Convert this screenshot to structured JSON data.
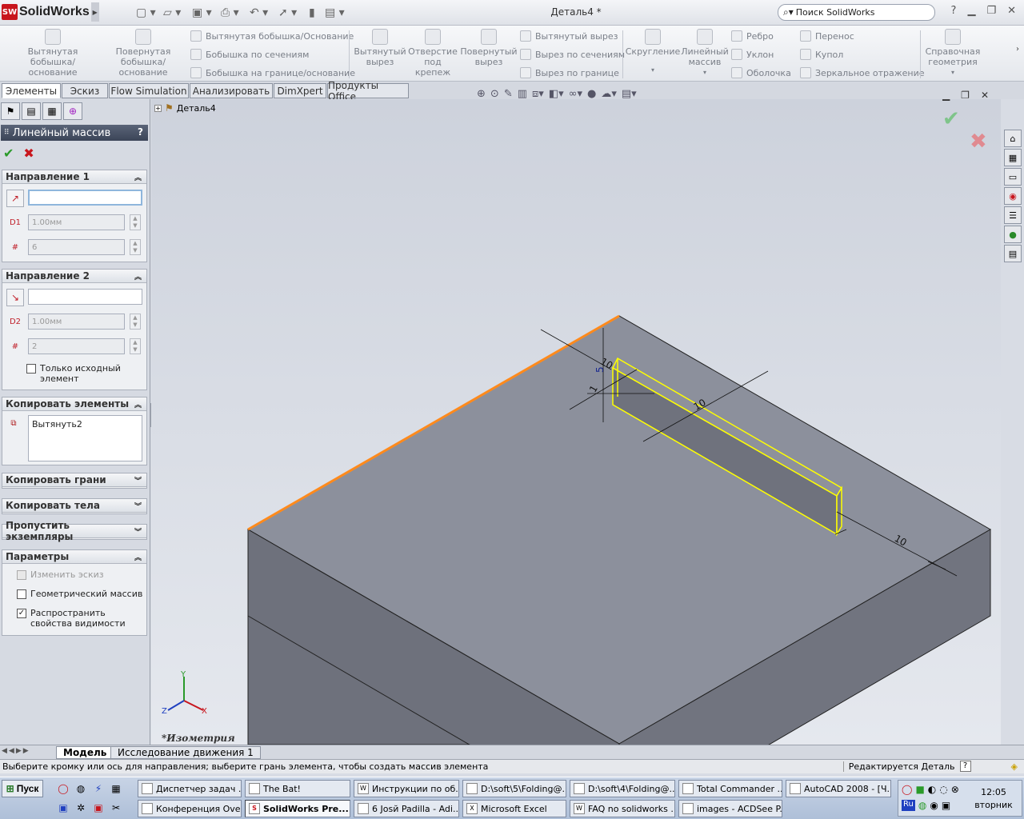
{
  "app": {
    "brand_badge": "SW",
    "brand": "SolidWorks",
    "document_title": "Деталь4 *",
    "search_placeholder": "Поиск SolidWorks",
    "help": "?"
  },
  "commands": {
    "big": [
      {
        "label": "Вытянутая бобышка/основание"
      },
      {
        "label": "Повернутая бобышка/основание"
      },
      {
        "label": "Вытянутый вырез"
      },
      {
        "label": "Отверстие под крепеж"
      },
      {
        "label": "Повернутый вырез"
      },
      {
        "label": "Скругление"
      },
      {
        "label": "Линейный массив"
      },
      {
        "label": "Справочная геометрия"
      }
    ],
    "small": [
      {
        "label": "Вытянутая бобышка/Основание"
      },
      {
        "label": "Бобышка по сечениям"
      },
      {
        "label": "Бобышка на границе/основание"
      },
      {
        "label": "Вытянутый вырез"
      },
      {
        "label": "Вырез по сечениям"
      },
      {
        "label": "Вырез по границе"
      },
      {
        "label": "Ребро"
      },
      {
        "label": "Уклон"
      },
      {
        "label": "Оболочка"
      },
      {
        "label": "Перенос"
      },
      {
        "label": "Купол"
      },
      {
        "label": "Зеркальное отражение"
      }
    ]
  },
  "tabs": [
    "Элементы",
    "Эскиз",
    "Flow Simulation",
    "Анализировать",
    "DimXpert",
    "Продукты Office"
  ],
  "property_manager": {
    "title": "Линейный массив",
    "help": "?",
    "direction1": {
      "header": "Направление 1",
      "distance_icon_label": "D1",
      "count_icon_label": "#",
      "spacing": "1.00мм",
      "count": "6"
    },
    "direction2": {
      "header": "Направление 2",
      "distance_icon_label": "D2",
      "count_icon_label": "#",
      "spacing": "1.00мм",
      "count": "2",
      "only_seed_label": "Только исходный элемент"
    },
    "copy_features": {
      "header": "Копировать элементы",
      "items": [
        "Вытянуть2"
      ]
    },
    "copy_faces": {
      "header": "Копировать грани"
    },
    "copy_bodies": {
      "header": "Копировать тела"
    },
    "skip_instances": {
      "header": "Пропустить экземпляры"
    },
    "options": {
      "header": "Параметры",
      "vary_sketch": {
        "label": "Изменить эскиз",
        "checked": false,
        "disabled": true
      },
      "geometry_pattern": {
        "label": "Геометрический массив",
        "checked": false
      },
      "propagate_visual": {
        "label": "Распространить свойства видимости",
        "checked": true
      }
    }
  },
  "viewport": {
    "tree_root": "Деталь4",
    "view_label": "*Изометрия",
    "dimensions": [
      "10",
      "5",
      "1",
      "10",
      "10"
    ],
    "triad": {
      "x": "X",
      "y": "Y",
      "z": "Z"
    },
    "colors": {
      "selected_edge": "#ff8a1c",
      "highlight": "#ffff00",
      "face_top": "#8c909c",
      "face_front": "#6e717c"
    }
  },
  "motion_tabs": [
    "Модель",
    "Исследование движения 1"
  ],
  "status": {
    "message": "Выберите кромку или ось для направления; выберите грань элемента, чтобы создать массив элемента",
    "mode": "Редактируется Деталь",
    "help": "?"
  },
  "taskbar": {
    "start": "Пуск",
    "row1": [
      "Диспетчер задач ...",
      "The Bat!",
      "Инструкции по об...",
      "D:\\soft\\5\\Folding@...",
      "D:\\soft\\4\\Folding@...",
      "Total Commander ...",
      "AutoCAD 2008 - [Ч..."
    ],
    "row2": [
      "Конференция Ove...",
      "SolidWorks Pre...",
      "6 Josй Padilla - Adi...",
      "Microsoft Excel",
      "FAQ no solidworks ...",
      "images - ACDSee P..."
    ],
    "tray_lang": "Ru",
    "clock_time": "12:05",
    "clock_day": "вторник"
  }
}
